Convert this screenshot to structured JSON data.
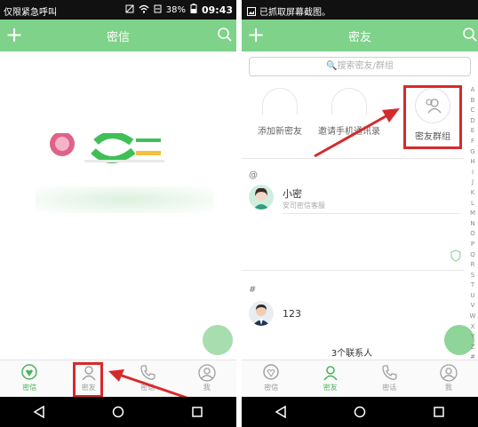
{
  "left": {
    "status": {
      "carrier": "仅限紧急呼叫",
      "battery": "38%",
      "time": "09:43"
    },
    "title": "密信",
    "tabs": [
      {
        "label": "密信",
        "icon": "chat-icon",
        "active": true
      },
      {
        "label": "密友",
        "icon": "contacts-icon",
        "active": false
      },
      {
        "label": "密话",
        "icon": "phone-icon",
        "active": false
      },
      {
        "label": "我",
        "icon": "profile-icon",
        "active": false
      }
    ]
  },
  "right": {
    "status": {
      "notice": "已抓取屏幕截图。"
    },
    "title": "密友",
    "search_placeholder": "搜索密友/群组",
    "quick_items": [
      {
        "label": "添加新密友"
      },
      {
        "label": "邀请手机通讯录"
      },
      {
        "label": "密友群组"
      }
    ],
    "sections": [
      {
        "header": "@",
        "contacts": [
          {
            "name": "小密",
            "sub": "安司密信客服"
          }
        ]
      },
      {
        "header": "#",
        "contacts": [
          {
            "name": "123",
            "sub": ""
          }
        ]
      }
    ],
    "contact_count": "3个联系人",
    "index_letters": [
      "A",
      "B",
      "C",
      "D",
      "E",
      "F",
      "G",
      "H",
      "I",
      "J",
      "K",
      "L",
      "M",
      "N",
      "O",
      "P",
      "Q",
      "R",
      "S",
      "T",
      "U",
      "V",
      "W",
      "X",
      "Y",
      "Z",
      "#"
    ],
    "tabs": [
      {
        "label": "密信",
        "icon": "chat-icon",
        "active": false
      },
      {
        "label": "密友",
        "icon": "contacts-icon",
        "active": true
      },
      {
        "label": "密话",
        "icon": "phone-icon",
        "active": false
      },
      {
        "label": "我",
        "icon": "profile-icon",
        "active": false
      }
    ]
  },
  "colors": {
    "brand_green": "#7fd289",
    "active_green": "#4bb35b",
    "callout_red": "#d62a2a"
  }
}
